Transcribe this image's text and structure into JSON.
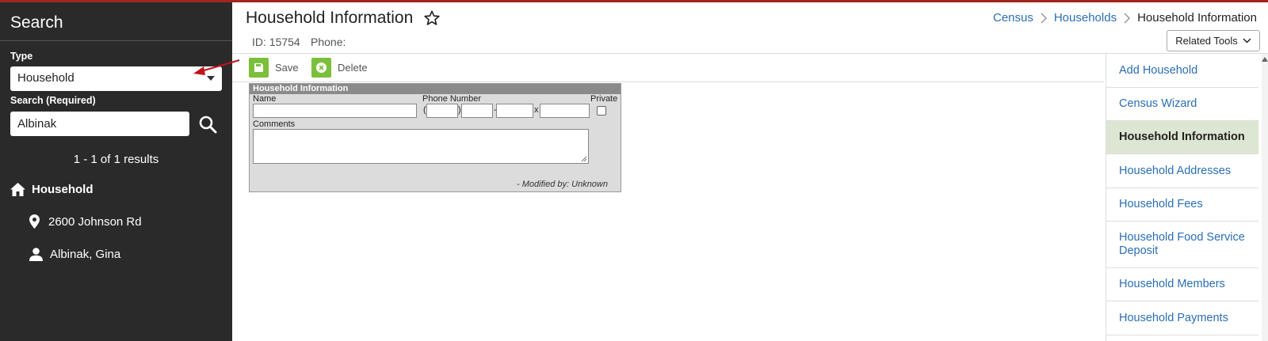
{
  "sidebar": {
    "title": "Search",
    "type_label": "Type",
    "type_value": "Household",
    "search_label": "Search (Required)",
    "search_value": "Albinak",
    "results_text": "1 - 1 of 1 results",
    "tree": {
      "household": "Household",
      "address": "2600 Johnson Rd",
      "member": "Albinak, Gina"
    }
  },
  "header": {
    "title": "Household Information",
    "id_label": "ID: 15754",
    "phone_label": "Phone:",
    "breadcrumb": [
      "Census",
      "Households",
      "Household Information"
    ],
    "related_tools": "Related Tools"
  },
  "toolbar": {
    "save_label": "Save",
    "delete_label": "Delete"
  },
  "form": {
    "section_title": "Household Information",
    "name_label": "Name",
    "phone_label": "Phone Number",
    "private_label": "Private",
    "comments_label": "Comments",
    "modified_text": "- Modified by: Unknown",
    "open_paren": "(",
    "close_paren": ")",
    "dash": "-",
    "ext": "x"
  },
  "right_panel": {
    "items": [
      "Add Household",
      "Census Wizard",
      "Household Information",
      "Household Addresses",
      "Household Fees",
      "Household Food Service Deposit",
      "Household Members",
      "Household Payments"
    ],
    "active_index": 2
  },
  "colors": {
    "sidebar_bg": "#2a2a2a",
    "link": "#2a6eb5",
    "accent_green": "#7cbf3b",
    "active_bg": "#dde6d2",
    "annotation_arrow": "#c0141c"
  }
}
